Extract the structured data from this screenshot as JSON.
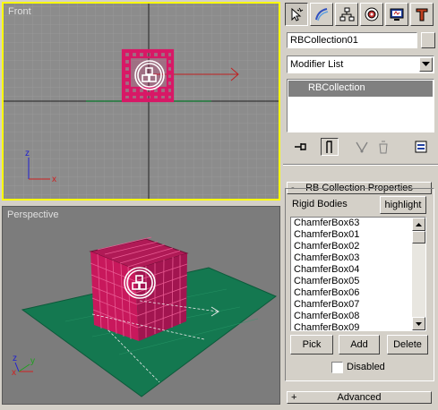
{
  "viewports": {
    "front": {
      "label": "Front"
    },
    "perspective": {
      "label": "Perspective"
    }
  },
  "axes": {
    "z": "z",
    "x": "x",
    "y": "y"
  },
  "command_panel": {
    "tabs": [
      {
        "icon": "create-icon",
        "active": true
      },
      {
        "icon": "modify-icon",
        "active": false
      },
      {
        "icon": "hierarchy-icon",
        "active": false
      },
      {
        "icon": "motion-icon",
        "active": false
      },
      {
        "icon": "display-icon",
        "active": false
      },
      {
        "icon": "utilities-icon",
        "active": false
      }
    ],
    "object_name": "RBCollection01",
    "modifier_list": {
      "selected": "Modifier List"
    },
    "modifier_stack": [
      "RBCollection"
    ],
    "rollouts": {
      "properties": {
        "sign": "-",
        "title": "RB Collection Properties",
        "rigid_bodies_label": "Rigid Bodies",
        "highlight_label": "highlight",
        "bodies": [
          "ChamferBox63",
          "ChamferBox01",
          "ChamferBox02",
          "ChamferBox03",
          "ChamferBox04",
          "ChamferBox05",
          "ChamferBox06",
          "ChamferBox07",
          "ChamferBox08",
          "ChamferBox09"
        ],
        "pick_label": "Pick",
        "add_label": "Add",
        "delete_label": "Delete",
        "disabled_label": "Disabled",
        "disabled_checked": false
      },
      "advanced": {
        "sign": "+",
        "title": "Advanced"
      }
    }
  },
  "colors": {
    "active_viewport_border": "#ffff00",
    "object": "#c8145a",
    "ground_plane": "#147850"
  }
}
